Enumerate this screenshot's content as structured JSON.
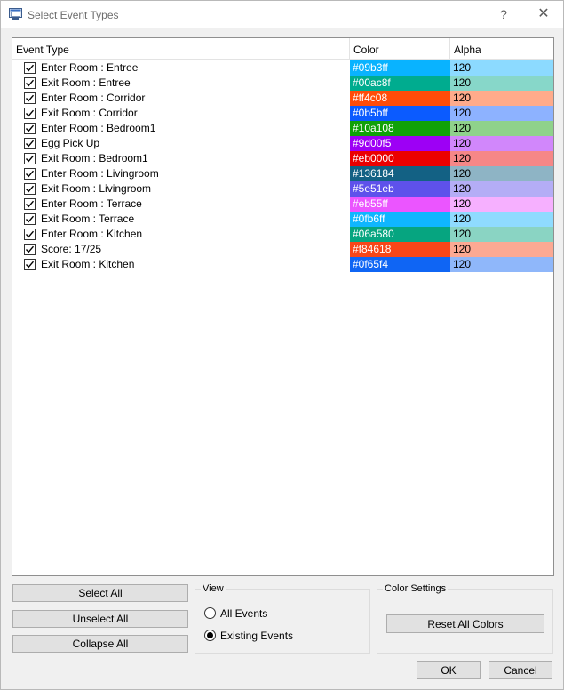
{
  "window": {
    "title": "Select Event Types",
    "help_glyph": "?",
    "close_glyph": "✕"
  },
  "table": {
    "headers": {
      "event": "Event Type",
      "color": "Color",
      "alpha": "Alpha"
    },
    "rows": [
      {
        "label": "Enter Room : Entree",
        "color": "#09b3ff",
        "alpha": "120",
        "alpha_bg": "#8cdaff"
      },
      {
        "label": "Exit Room : Entree",
        "color": "#00ac8f",
        "alpha": "120",
        "alpha_bg": "#87d7c9"
      },
      {
        "label": "Enter Room : Corridor",
        "color": "#ff4c08",
        "alpha": "120",
        "alpha_bg": "#ffab8b"
      },
      {
        "label": "Exit Room : Corridor",
        "color": "#0b5bff",
        "alpha": "120",
        "alpha_bg": "#8db2ff"
      },
      {
        "label": "Enter Room : Bedroom1",
        "color": "#10a108",
        "alpha": "120",
        "alpha_bg": "#8fd28b"
      },
      {
        "label": "Egg Pick Up",
        "color": "#9d00f5",
        "alpha": "120",
        "alpha_bg": "#d187fb"
      },
      {
        "label": "Exit Room : Bedroom1",
        "color": "#eb0000",
        "alpha": "120",
        "alpha_bg": "#f68787"
      },
      {
        "label": "Enter Room : Livingroom",
        "color": "#136184",
        "alpha": "120",
        "alpha_bg": "#8eb4c5"
      },
      {
        "label": "Exit Room : Livingroom",
        "color": "#5e51eb",
        "alpha": "120",
        "alpha_bg": "#b4adf6"
      },
      {
        "label": "Enter Room : Terrace",
        "color": "#eb55ff",
        "alpha": "120",
        "alpha_bg": "#f6b0ff"
      },
      {
        "label": "Exit Room : Terrace",
        "color": "#0fb6ff",
        "alpha": "120",
        "alpha_bg": "#8fdbff"
      },
      {
        "label": "Enter Room : Kitchen",
        "color": "#06a580",
        "alpha": "120",
        "alpha_bg": "#8ad4c3"
      },
      {
        "label": "Score: 17/25",
        "color": "#f84618",
        "alpha": "120",
        "alpha_bg": "#fca993"
      },
      {
        "label": "Exit Room : Kitchen",
        "color": "#0f65f4",
        "alpha": "120",
        "alpha_bg": "#8fb7fa"
      }
    ]
  },
  "buttons": {
    "select_all": "Select All",
    "unselect_all": "Unselect All",
    "collapse_all": "Collapse All",
    "reset_all_colors": "Reset All Colors",
    "ok": "OK",
    "cancel": "Cancel"
  },
  "view": {
    "title": "View",
    "options": [
      {
        "label": "All Events",
        "selected": false
      },
      {
        "label": "Existing Events",
        "selected": true
      }
    ]
  },
  "color_settings": {
    "title": "Color Settings"
  }
}
